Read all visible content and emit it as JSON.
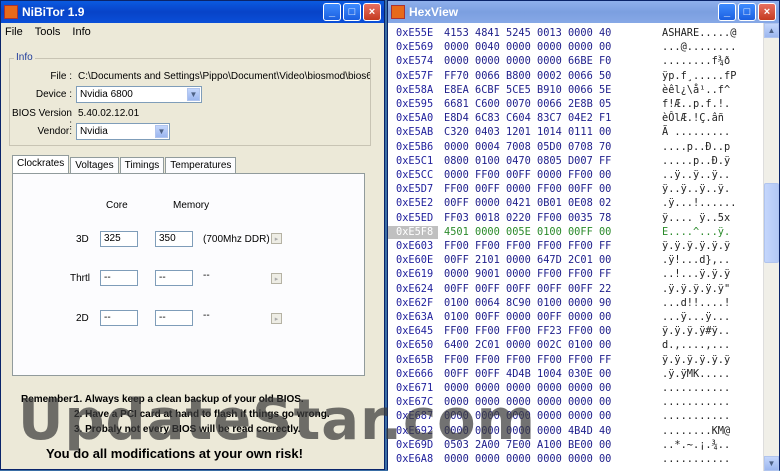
{
  "nibitor": {
    "title": "NiBiTor 1.9",
    "menu": [
      "File",
      "Tools",
      "Info"
    ],
    "info": {
      "group_title": "Info",
      "file_label": "File :",
      "file_value": "C:\\Documents and Settings\\Pippo\\Document\\Video\\biosmod\\bios6800nvidia.rom",
      "device_label": "Device :",
      "device_value": "Nvidia 6800",
      "bios_label": "BIOS Version :",
      "bios_value": "5.40.02.12.01",
      "vendor_label": "Vendor:",
      "vendor_value": "Nvidia"
    },
    "tabs": [
      "Clockrates",
      "Voltages",
      "Timings",
      "Temperatures"
    ],
    "clock": {
      "core_label": "Core",
      "memory_label": "Memory",
      "rows": [
        {
          "label": "3D",
          "core": "325",
          "memory": "350",
          "note": "(700Mhz DDR)"
        },
        {
          "label": "Thrtl",
          "core": "--",
          "memory": "--",
          "note": "--"
        },
        {
          "label": "2D",
          "core": "--",
          "memory": "--",
          "note": "--"
        }
      ]
    },
    "remember_label": "Remember:",
    "remember_items": [
      "1. Always keep a clean backup of your old BIOS.",
      "2. Have a PCI card at hand to flash if things go wrong.",
      "3. Probaly not every BIOS will be read correctly."
    ],
    "big_warning": "You do all modifications at your own risk!"
  },
  "hexview": {
    "title": "HexView",
    "rows": [
      {
        "addr": "0xE55E",
        "bytes": "4153 4841 5245 0013 0000 40",
        "ascii": "ASHARE.....@"
      },
      {
        "addr": "0xE569",
        "bytes": "0000 0040 0000 0000 0000 00",
        "ascii": "...@........"
      },
      {
        "addr": "0xE574",
        "bytes": "0000 0000 0000 0000 66BE F0",
        "ascii": "........f¾ð"
      },
      {
        "addr": "0xE57F",
        "bytes": "FF70 0066 B800 0002 0066 50",
        "ascii": "ÿp.f¸.....fP"
      },
      {
        "addr": "0xE58A",
        "bytes": "E8EA 6CBF 5CE5 B910 0066 5E",
        "ascii": "èêl¿\\å¹..f^"
      },
      {
        "addr": "0xE595",
        "bytes": "6681 C600 0070 0066 2E8B 05",
        "ascii": "f!Æ..p.f.!."
      },
      {
        "addr": "0xE5A0",
        "bytes": "E8D4 6C83 C604 83C7 04E2 F1",
        "ascii": "èÔlÆ.!Ç.âñ"
      },
      {
        "addr": "0xE5AB",
        "bytes": "C320 0403 1201 1014 0111 00",
        "ascii": "Ã ........."
      },
      {
        "addr": "0xE5B6",
        "bytes": "0000 0004 7008 05D0 0708 70",
        "ascii": "....p..Ð..p"
      },
      {
        "addr": "0xE5C1",
        "bytes": "0800 0100 0470 0805 D007 FF",
        "ascii": ".....p..Ð.ÿ"
      },
      {
        "addr": "0xE5CC",
        "bytes": "0000 FF00 00FF 0000 FF00 00",
        "ascii": "..ÿ..ÿ..ÿ.."
      },
      {
        "addr": "0xE5D7",
        "bytes": "FF00 00FF 0000 FF00 00FF 00",
        "ascii": "ÿ..ÿ..ÿ..ÿ."
      },
      {
        "addr": "0xE5E2",
        "bytes": "00FF 0000 0421 0B01 0E08 02",
        "ascii": ".ÿ...!......"
      },
      {
        "addr": "0xE5ED",
        "bytes": "FF03 0018 0220 FF00 0035 78",
        "ascii": "ÿ.... ÿ..5x"
      },
      {
        "addr": "0xE5F8",
        "bytes": "4501 0000 005E 0100 00FF 00",
        "ascii": "E....^...ÿ."
      },
      {
        "addr": "0xE603",
        "bytes": "FF00 FF00 FF00 FF00 FF00 FF",
        "ascii": "ÿ.ÿ.ÿ.ÿ.ÿ.ÿ"
      },
      {
        "addr": "0xE60E",
        "bytes": "00FF 2101 0000 647D 2C01 00",
        "ascii": ".ÿ!...d},.."
      },
      {
        "addr": "0xE619",
        "bytes": "0000 9001 0000 FF00 FF00 FF",
        "ascii": "..!...ÿ.ÿ.ÿ"
      },
      {
        "addr": "0xE624",
        "bytes": "00FF 00FF 00FF 00FF 00FF 22",
        "ascii": ".ÿ.ÿ.ÿ.ÿ.ÿ\""
      },
      {
        "addr": "0xE62F",
        "bytes": "0100 0064 8C90 0100 0000 90",
        "ascii": "...d!!....!"
      },
      {
        "addr": "0xE63A",
        "bytes": "0100 00FF 0000 00FF 0000 00",
        "ascii": "...ÿ...ÿ..."
      },
      {
        "addr": "0xE645",
        "bytes": "FF00 FF00 FF00 FF23 FF00 00",
        "ascii": "ÿ.ÿ.ÿ.ÿ#ÿ.."
      },
      {
        "addr": "0xE650",
        "bytes": "6400 2C01 0000 002C 0100 00",
        "ascii": "d.,....,..."
      },
      {
        "addr": "0xE65B",
        "bytes": "FF00 FF00 FF00 FF00 FF00 FF",
        "ascii": "ÿ.ÿ.ÿ.ÿ.ÿ.ÿ"
      },
      {
        "addr": "0xE666",
        "bytes": "00FF 00FF 4D4B 1004 030E 00",
        "ascii": ".ÿ.ÿMK....."
      },
      {
        "addr": "0xE671",
        "bytes": "0000 0000 0000 0000 0000 00",
        "ascii": "..........."
      },
      {
        "addr": "0xE67C",
        "bytes": "0000 0000 0000 0000 0000 00",
        "ascii": "..........."
      },
      {
        "addr": "0xE687",
        "bytes": "0000 0000 0000 0000 0000 00",
        "ascii": "..........."
      },
      {
        "addr": "0xE692",
        "bytes": "0000 0000 0000 0000 4B4D 40",
        "ascii": "........KM@"
      },
      {
        "addr": "0xE69D",
        "bytes": "0503 2A00 7E00 A100 BE00 00",
        "ascii": "..*.~.¡.¾.."
      },
      {
        "addr": "0xE6A8",
        "bytes": "0000 0000 0000 0000 0000 00",
        "ascii": "..........."
      }
    ],
    "selected_index": 14
  },
  "watermark": "UpdateStar.com",
  "colors": {
    "accent": "#0a4fd8",
    "selected_row": "#c0c0c0",
    "highlight_text": "#2a8a2a"
  }
}
